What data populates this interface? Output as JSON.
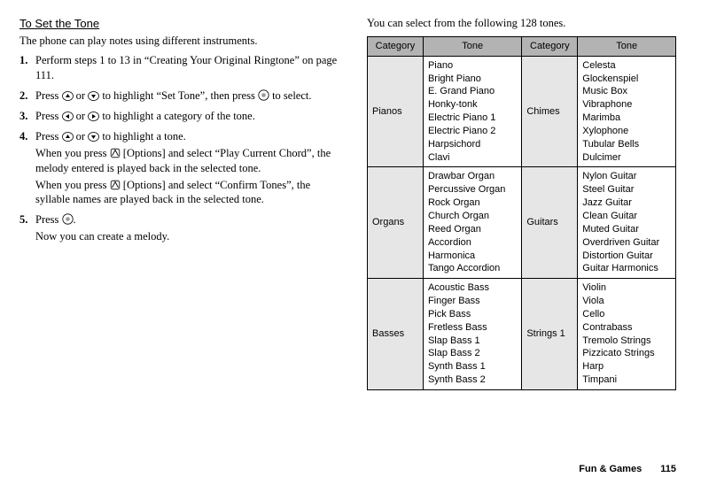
{
  "left": {
    "title": "To Set the Tone",
    "intro": "The phone can play notes using different instruments.",
    "steps": {
      "s1": {
        "num": "1.",
        "text": "Perform steps 1 to 13 in “Creating Your Original Ringtone” on page 111."
      },
      "s2": {
        "num": "2.",
        "pre": "Press ",
        "mid1": " or ",
        "mid2": " to highlight “Set Tone”, then press ",
        "post": " to select."
      },
      "s3": {
        "num": "3.",
        "pre": "Press ",
        "mid": " or ",
        "post": " to highlight a category of the tone."
      },
      "s4": {
        "num": "4.",
        "pre": "Press ",
        "mid": " or ",
        "post1": " to highlight a tone.",
        "sub1a": "When you press ",
        "sub1b": " [Options] and select “Play Current Chord”, the melody entered is played back in the selected tone.",
        "sub2a": "When you press ",
        "sub2b": " [Options] and select “Confirm Tones”, the syllable names are played back in the selected tone."
      },
      "s5": {
        "num": "5.",
        "pre": "Press ",
        "post": ".",
        "sub": "Now you can create a melody."
      }
    }
  },
  "right": {
    "intro": "You can select from the following 128 tones.",
    "headers": {
      "cat": "Category",
      "tone": "Tone"
    },
    "rows": {
      "r1": {
        "catA": "Pianos",
        "tonesA": [
          "Piano",
          "Bright Piano",
          "E. Grand Piano",
          "Honky-tonk",
          "Electric Piano 1",
          "Electric Piano 2",
          "Harpsichord",
          "Clavi"
        ],
        "catB": "Chimes",
        "tonesB": [
          "Celesta",
          "Glockenspiel",
          "Music Box",
          "Vibraphone",
          "Marimba",
          "Xylophone",
          "Tubular Bells",
          "Dulcimer"
        ]
      },
      "r2": {
        "catA": "Organs",
        "tonesA": [
          "Drawbar Organ",
          "Percussive Organ",
          "Rock Organ",
          "Church Organ",
          "Reed Organ",
          "Accordion",
          "Harmonica",
          "Tango Accordion"
        ],
        "catB": "Guitars",
        "tonesB": [
          "Nylon Guitar",
          "Steel Guitar",
          "Jazz Guitar",
          "Clean Guitar",
          "Muted Guitar",
          "Overdriven Guitar",
          "Distortion Guitar",
          "Guitar Harmonics"
        ]
      },
      "r3": {
        "catA": "Basses",
        "tonesA": [
          "Acoustic Bass",
          "Finger Bass",
          "Pick Bass",
          "Fretless Bass",
          "Slap Bass 1",
          "Slap Bass 2",
          "Synth Bass 1",
          "Synth Bass 2"
        ],
        "catB": "Strings 1",
        "tonesB": [
          "Violin",
          "Viola",
          "Cello",
          "Contrabass",
          "Tremolo Strings",
          "Pizzicato Strings",
          "Harp",
          "Timpani"
        ]
      }
    }
  },
  "footer": {
    "section": "Fun & Games",
    "page": "115"
  }
}
